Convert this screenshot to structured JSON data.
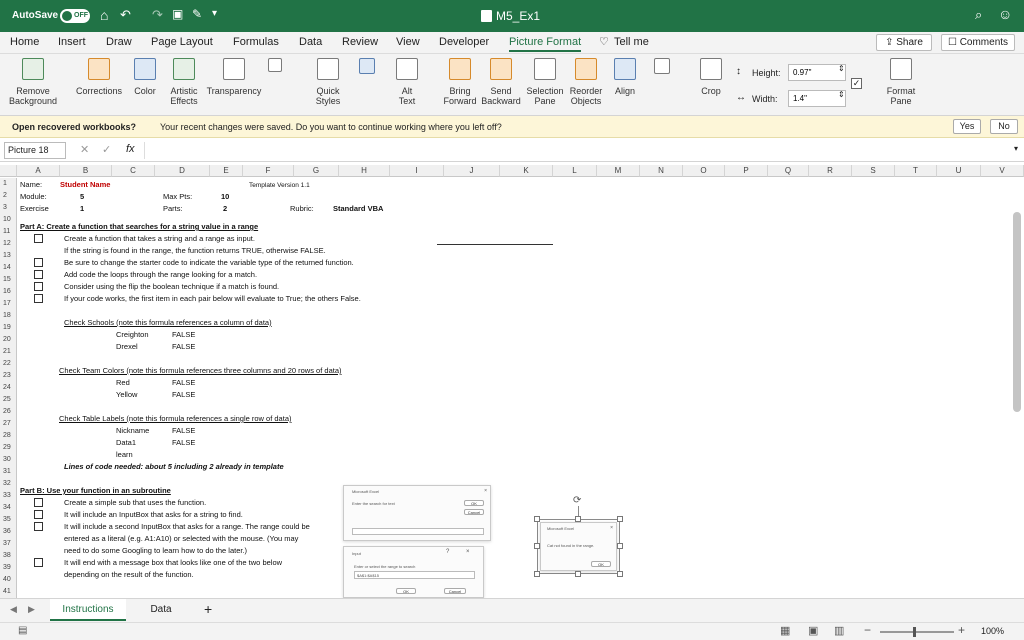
{
  "titlebar": {
    "autosave_label": "AutoSave",
    "autosave_state": "OFF",
    "file_title": "M5_Ex1"
  },
  "tabs": [
    "Home",
    "Insert",
    "Draw",
    "Page Layout",
    "Formulas",
    "Data",
    "Review",
    "View",
    "Developer",
    "Picture Format",
    "Tell me"
  ],
  "share_label": "Share",
  "comments_label": "Comments",
  "ribbon": {
    "remove_bg": "Remove\nBackground",
    "corrections": "Corrections",
    "color": "Color",
    "artistic": "Artistic\nEffects",
    "transparency": "Transparency",
    "quick_styles": "Quick\nStyles",
    "alt_text": "Alt\nText",
    "bring_forward": "Bring\nForward",
    "send_backward": "Send\nBackward",
    "selection_pane": "Selection\nPane",
    "reorder": "Reorder\nObjects",
    "align": "Align",
    "crop": "Crop",
    "height_label": "Height:",
    "height_value": "0.97\"",
    "width_label": "Width:",
    "width_value": "1.4\"",
    "format_pane": "Format\nPane"
  },
  "message": {
    "title": "Open recovered workbooks?",
    "text": "Your recent changes were saved. Do you want to continue working where you left off?",
    "yes": "Yes",
    "no": "No"
  },
  "formula_bar": {
    "name_box": "Picture 18",
    "fx": "fx",
    "formula": ""
  },
  "columns": [
    "A",
    "B",
    "C",
    "D",
    "E",
    "F",
    "G",
    "H",
    "I",
    "J",
    "K",
    "L",
    "M",
    "N",
    "O",
    "P",
    "Q",
    "R",
    "S",
    "T",
    "U",
    "V"
  ],
  "rows": [
    "1",
    "2",
    "3",
    "10",
    "11",
    "12",
    "13",
    "14",
    "15",
    "16",
    "17",
    "18",
    "19",
    "20",
    "21",
    "22",
    "23",
    "24",
    "25",
    "26",
    "27",
    "28",
    "29",
    "30",
    "31",
    "32",
    "33",
    "34",
    "35",
    "36",
    "37",
    "38",
    "39",
    "40",
    "41"
  ],
  "cells": {
    "name_label": "Name:",
    "student_name": "Student Name",
    "template_version": "Template Version 1.1",
    "module_label": "Module:",
    "module_value": "5",
    "max_pts_label": "Max Pts:",
    "max_pts_value": "10",
    "exercise_label": "Exercise",
    "exercise_value": "1",
    "parts_label": "Parts:",
    "parts_value": "2",
    "rubric_label": "Rubric:",
    "rubric_value": "Standard VBA",
    "part_a": "Part A: Create a function that searches for a string value in a range",
    "a1": "Create a function that takes a string and a range as input.",
    "a2": "If the string is found in the range, the function returns TRUE, otherwise FALSE.",
    "a3": "Be sure to change the starter code to indicate the variable type of the returned function.",
    "a4": "Add code the loops through the range looking for a match.",
    "a5": "Consider using the flip the boolean technique if a match is found.",
    "a6": "If your code works, the first item in each pair below will evaluate to True; the others False.",
    "check_schools": "Check Schools (note this formula references a column of data)",
    "creighton": "Creighton",
    "drexel": "Drexel",
    "check_colors": "Check Team Colors (note this formula references three columns and 20 rows of data)",
    "red": "Red",
    "yellow": "Yellow",
    "check_labels": "Check Table Labels (note this formula references a single row of data)",
    "nickname": "Nickname",
    "data1": "Data1",
    "learn": "learn",
    "false": "FALSE",
    "lines_needed": "Lines of code needed: about 5 including 2 already in template",
    "part_b": "Part B: Use your function in an subroutine",
    "b1": "Create a simple sub that uses the function.",
    "b2": "It will include an InputBox that asks for a string to find.",
    "b3": "It will include a second InputBox that asks for a range. The range could be",
    "b4": "entered as a literal (e.g. A1:A10) or selected with the mouse. (You may",
    "b5": "need to do some Googling to learn how to do the later.)",
    "b6": "It will end with a message box that looks like one of the two below",
    "b7": "depending on the result of the function."
  },
  "dialogs": {
    "d1_title": "Microsoft Excel",
    "d1_prompt": "Enter the search for text",
    "d1_ok": "OK",
    "d1_cancel": "Cancel",
    "d1_close": "×",
    "d2_title": "Input",
    "d2_help": "?",
    "d2_close": "×",
    "d2_prompt": "Enter or select the range to search",
    "d2_value": "$A$1:$A$15",
    "d2_ok": "OK",
    "d2_cancel": "Cancel",
    "d3_title": "Microsoft Excel",
    "d3_text": "Cat not found in the range.",
    "d3_ok": "OK",
    "d3_close": "×"
  },
  "sheet_tabs": [
    "Instructions",
    "Data"
  ],
  "add_sheet": "+",
  "zoom": "100%",
  "colors": {
    "excel_green": "#217346",
    "active_tab": "#217346",
    "student_red": "#c00000"
  }
}
